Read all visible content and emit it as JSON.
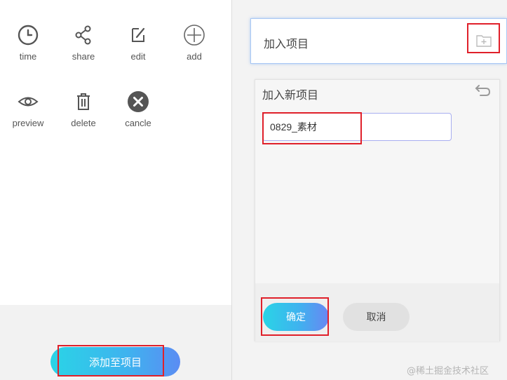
{
  "toolbar": {
    "items": [
      {
        "label": "time",
        "icon": "clock-icon"
      },
      {
        "label": "share",
        "icon": "share-icon"
      },
      {
        "label": "edit",
        "icon": "edit-icon"
      },
      {
        "label": "add",
        "icon": "plus-circle-icon"
      },
      {
        "label": "preview",
        "icon": "eye-icon"
      },
      {
        "label": "delete",
        "icon": "trash-icon"
      },
      {
        "label": "cancle",
        "icon": "close-circle-icon"
      }
    ]
  },
  "footer": {
    "add_to_project_label": "添加至项目"
  },
  "panel": {
    "title": "加入项目",
    "folder_icon": "folder-add-icon"
  },
  "dialog": {
    "title": "加入新项目",
    "back_icon": "undo-icon",
    "input_value": "0829_素材",
    "confirm_label": "确定",
    "cancel_label": "取消"
  },
  "watermark": "@稀土掘金技术社区",
  "colors": {
    "accent_start": "#2ad4e6",
    "accent_end": "#5b8cf3",
    "highlight": "#e0202a"
  }
}
